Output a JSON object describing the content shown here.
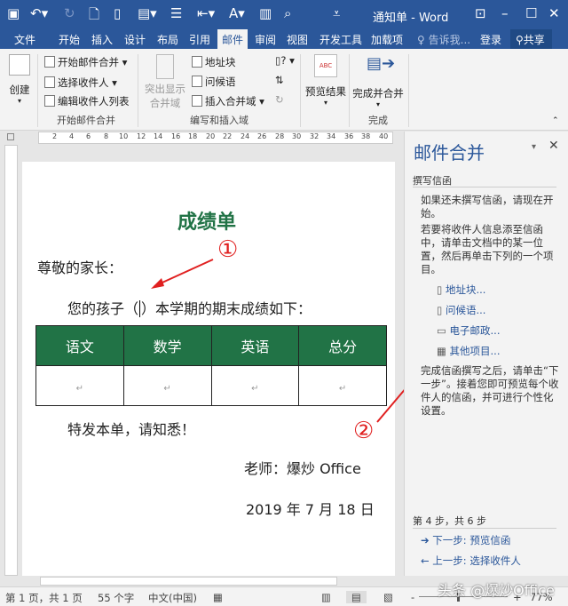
{
  "window": {
    "title": "通知单 - Word"
  },
  "tabs": [
    "文件",
    "开始",
    "插入",
    "设计",
    "布局",
    "引用",
    "邮件",
    "审阅",
    "视图",
    "开发工具",
    "加载项"
  ],
  "tell_me": "告诉我...",
  "login": "登录",
  "share": "共享",
  "ribbon": {
    "create": "创建",
    "start_group": {
      "items": [
        "开始邮件合并",
        "选择收件人",
        "编辑收件人列表"
      ],
      "label": "开始邮件合并"
    },
    "write_group": {
      "highlight": "突出显示",
      "highlight2": "合并域",
      "items": [
        "地址块",
        "问候语",
        "插入合并域"
      ],
      "label": "编写和插入域"
    },
    "preview": "预览结果",
    "finish": {
      "button": "完成并合并",
      "label": "完成"
    },
    "abc": "ABC"
  },
  "ruler": [
    "2",
    "4",
    "6",
    "8",
    "10",
    "12",
    "14",
    "16",
    "18",
    "20",
    "22",
    "24",
    "26",
    "28",
    "30",
    "32",
    "34",
    "36",
    "38",
    "40"
  ],
  "document": {
    "title": "成绩单",
    "greeting": "尊敬的家长：",
    "line1a": "您的孩子（",
    "line1b": "）本学期的期末成绩如下：",
    "table_headers": [
      "语文",
      "数学",
      "英语",
      "总分"
    ],
    "closing": "特发本单，请知悉！",
    "teacher": "老师：爆炒 Office",
    "date": "2019 年 7 月 18 日",
    "return_mark": "↵"
  },
  "annotations": [
    "①",
    "②"
  ],
  "pane": {
    "title": "邮件合并",
    "section": "撰写信函",
    "p1": "如果还未撰写信函，请现在开始。",
    "p2": "若要将收件人信息添至信函中，请单击文档中的某一位置，然后再单击下列的一个项目。",
    "links": [
      "地址块...",
      "问候语...",
      "电子邮政...",
      "其他项目..."
    ],
    "p3": "完成信函撰写之后，请单击“下一步”。接着您即可预览每个收件人的信函，并可进行个性化设置。",
    "step": "第 4 步，共 6 步",
    "next": "下一步: 预览信函",
    "prev": "上一步: 选择收件人"
  },
  "status": {
    "page": "第 1 页，共 1 页",
    "words": "55 个字",
    "lang": "中文(中国)",
    "zoom": "77%",
    "zoom_minus": "-",
    "zoom_plus": "+"
  },
  "watermark": "头条 @爆炒Office"
}
